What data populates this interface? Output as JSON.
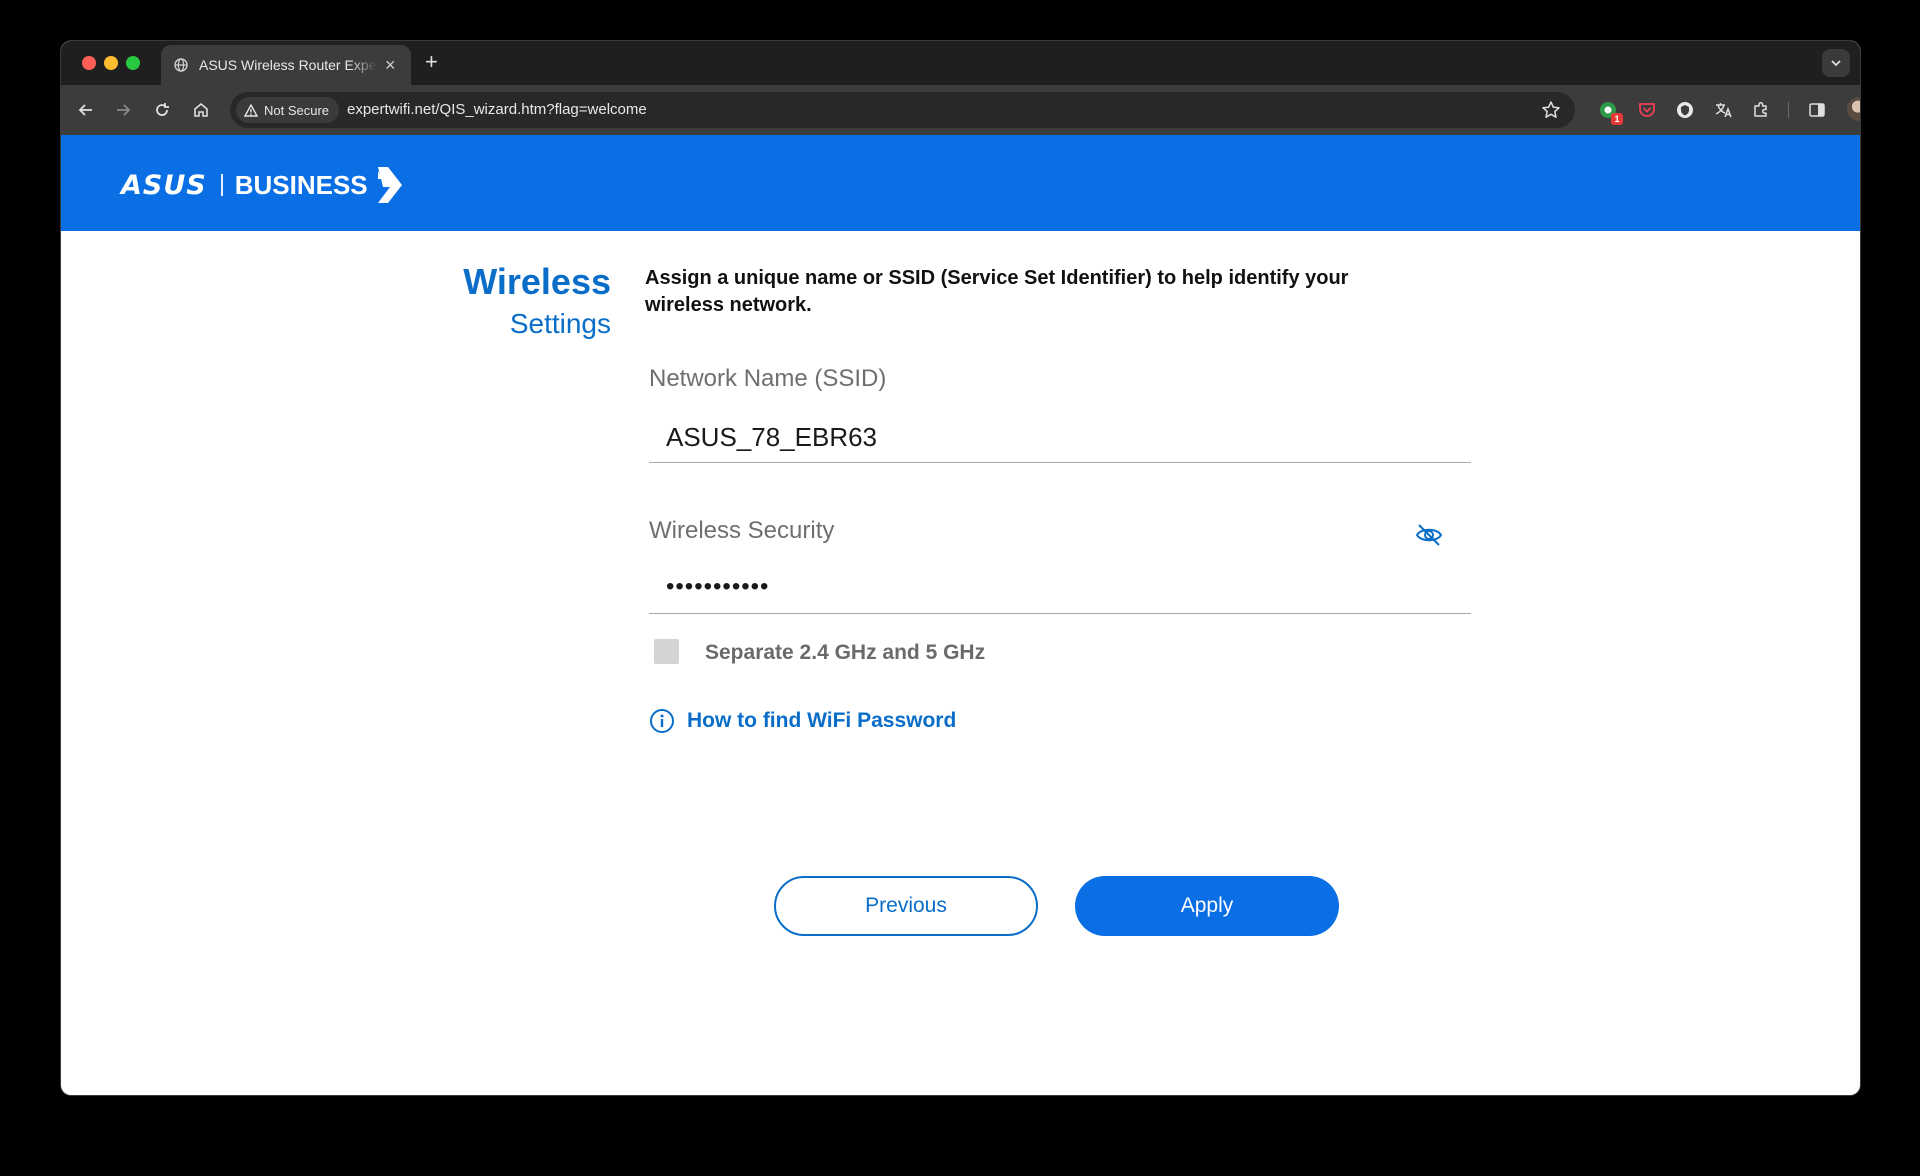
{
  "browser": {
    "tab_title": "ASUS Wireless Router Expert",
    "tab_close": "×",
    "new_tab": "+",
    "security_label": "Not Secure",
    "url": "expertwifi.net/QIS_wizard.htm?flag=welcome",
    "extension_badge": "1"
  },
  "brand": {
    "logo_asus": "ASUS",
    "logo_business": "BUSINESS",
    "bar_color": "#0a6ee4"
  },
  "page": {
    "title_line1": "Wireless",
    "title_line2": "Settings",
    "description": "Assign a unique name or SSID (Service Set Identifier) to help identify your wireless network.",
    "ssid_label": "Network Name (SSID)",
    "ssid_value": "ASUS_78_EBR63",
    "security_label": "Wireless Security",
    "security_value": "•••••••••••",
    "separate_bands_label": "Separate 2.4 GHz and 5 GHz",
    "separate_bands_checked": false,
    "help_link": "How to find WiFi Password",
    "accent_color": "#0a6ec9"
  },
  "buttons": {
    "previous": "Previous",
    "apply": "Apply"
  },
  "icons": {
    "tab_favicon": "globe-icon",
    "back": "arrow-left-icon",
    "forward": "arrow-right-icon",
    "reload": "reload-icon",
    "home": "home-icon",
    "security": "warning-triangle-icon",
    "bookmark": "star-icon",
    "password_visibility": "eye-off-icon",
    "help": "info-circle-icon"
  }
}
